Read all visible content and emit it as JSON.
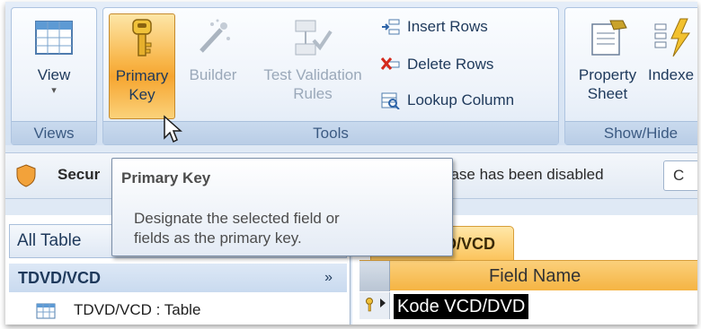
{
  "ribbon": {
    "views": {
      "label": "Views",
      "view_button": "View",
      "view_dropdown": "▾"
    },
    "tools": {
      "label": "Tools",
      "primary_key": [
        "Primary",
        "Key"
      ],
      "builder": "Builder",
      "test_validation": [
        "Test Validation",
        "Rules"
      ],
      "insert_rows": "Insert Rows",
      "delete_rows": "Delete Rows",
      "lookup_column": "Lookup Column"
    },
    "showhide": {
      "label": "Show/Hide",
      "property_sheet": [
        "Property",
        "Sheet"
      ],
      "indexes": "Indexe"
    }
  },
  "security_bar": {
    "left_text": "Secur",
    "right_text": "base has been disabled",
    "option_button": "C"
  },
  "tooltip": {
    "title": "Primary Key",
    "body_line1": "Designate the selected field or",
    "body_line2": "fields as the primary key."
  },
  "nav_pane": {
    "header": "All Table",
    "group": "TDVD/VCD",
    "group_chevron": "»",
    "item": "TDVD/VCD : Table"
  },
  "design": {
    "tab_label": "D/VCD",
    "column_header": "Field Name",
    "field_value": "Kode VCD/DVD"
  },
  "colors": {
    "hover_orange": "#f6a530",
    "ribbon_blue": "#dfe9f5"
  }
}
